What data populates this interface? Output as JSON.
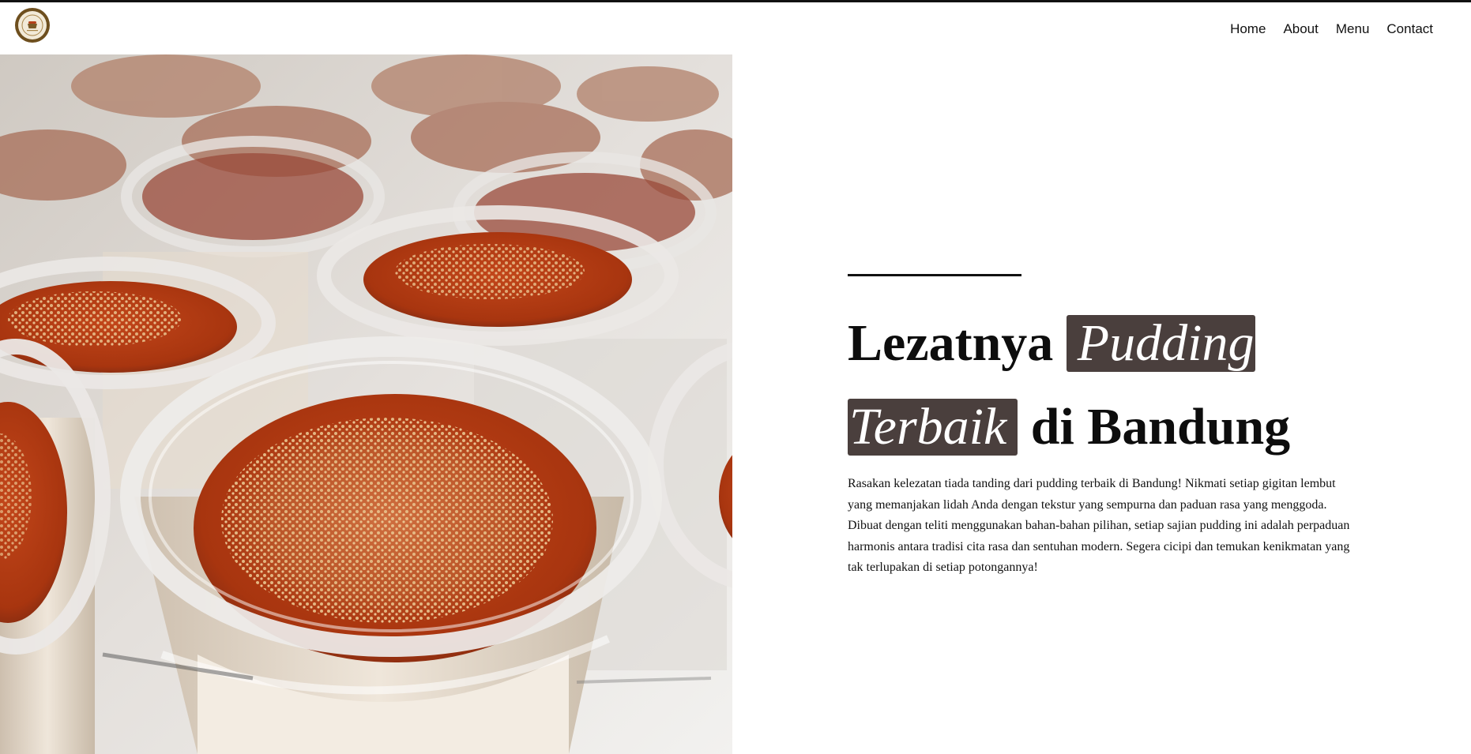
{
  "header": {
    "logo_name": "pudding-brand-logo",
    "nav": [
      "Home",
      "About",
      "Menu",
      "Contact"
    ]
  },
  "hero": {
    "image_alt": "pudding cups with caramel and crumble topping",
    "title_part1": "Lezatnya",
    "title_highlight1": "Pudding",
    "title_highlight2": "Terbaik",
    "title_part2": "di Bandung",
    "description": "Rasakan kelezatan tiada tanding dari pudding terbaik di Bandung! Nikmati setiap gigitan lembut yang memanjakan lidah Anda dengan tekstur yang sempurna dan paduan rasa yang menggoda. Dibuat dengan teliti menggunakan bahan-bahan pilihan, setiap sajian pudding ini adalah perpaduan harmonis antara tradisi cita rasa dan sentuhan modern. Segera cicipi dan temukan kenikmatan yang tak terlupakan di setiap potongannya!"
  },
  "colors": {
    "highlight_bg": "#4a3f3d",
    "logo_brown": "#6e4f1e",
    "caramel": "#b5421a"
  }
}
